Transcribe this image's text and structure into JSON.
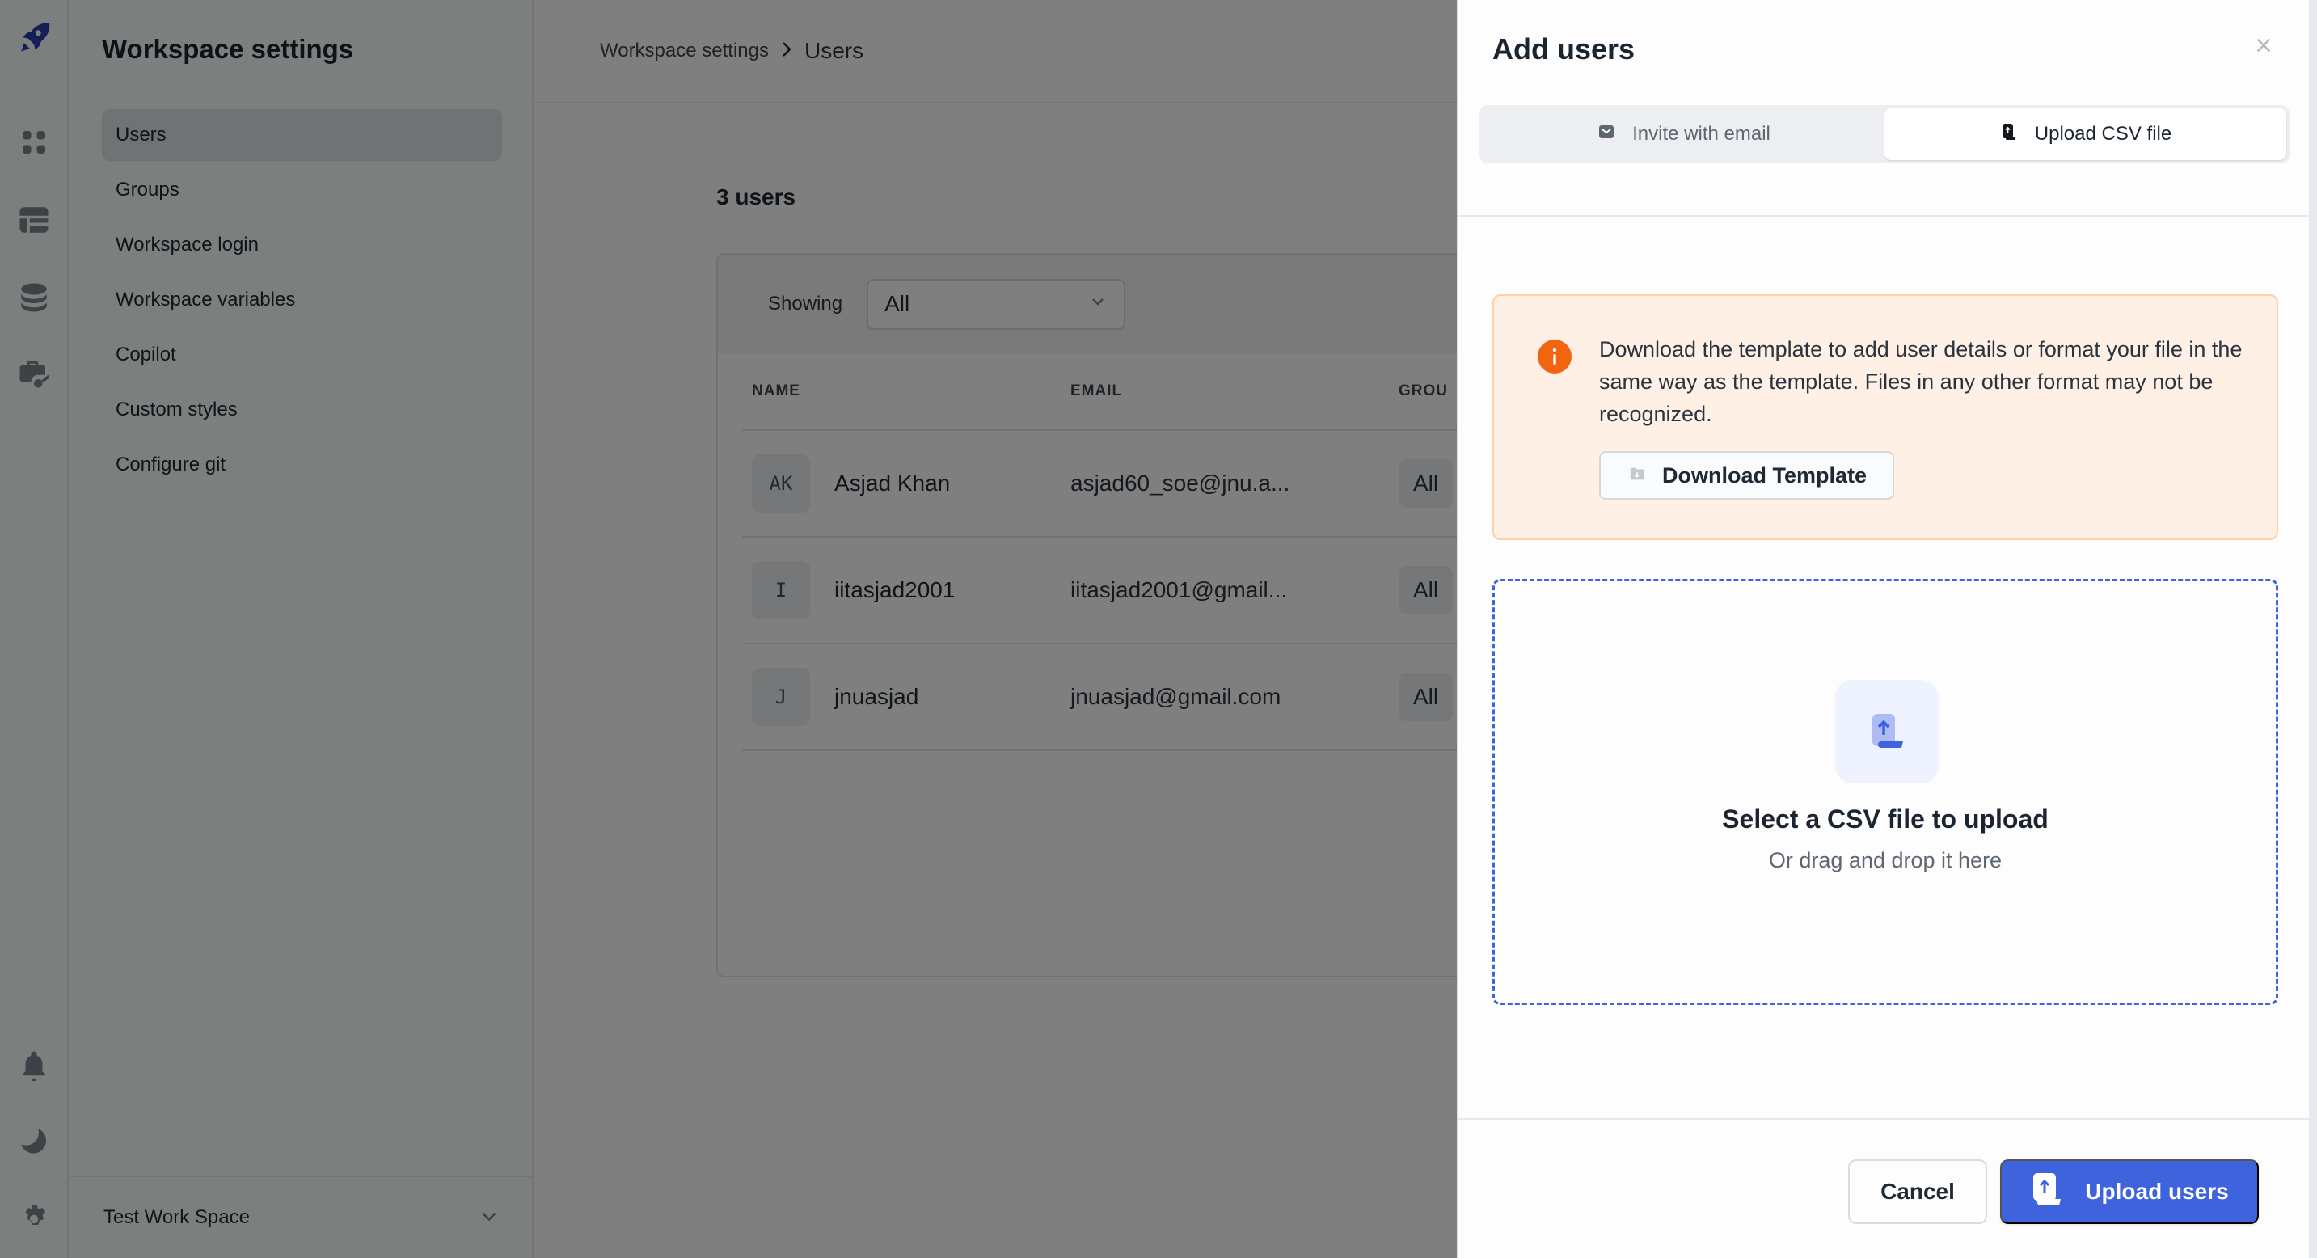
{
  "rail": {
    "icons": [
      "rocket-logo-icon",
      "apps-grid-icon",
      "table-layout-icon",
      "database-icon",
      "workspace-key-icon",
      "bell-icon",
      "moon-icon",
      "gear-icon"
    ],
    "logo_color": "#2c3cb0"
  },
  "sidebar": {
    "title": "Workspace settings",
    "items": [
      {
        "label": "Users",
        "active": true
      },
      {
        "label": "Groups",
        "active": false
      },
      {
        "label": "Workspace login",
        "active": false
      },
      {
        "label": "Workspace variables",
        "active": false
      },
      {
        "label": "Copilot",
        "active": false
      },
      {
        "label": "Custom styles",
        "active": false
      },
      {
        "label": "Configure git",
        "active": false
      }
    ],
    "workspace_name": "Test Work Space"
  },
  "main": {
    "breadcrumb": {
      "parent": "Workspace settings",
      "current": "Users"
    },
    "users_count": "3 users",
    "filter": {
      "label": "Showing",
      "value": "All"
    },
    "table": {
      "headers": {
        "name": "NAME",
        "email": "EMAIL",
        "groups": "GROU"
      },
      "rows": [
        {
          "initials": "AK",
          "name": "Asjad Khan",
          "email": "asjad60_soe@jnu.a...",
          "group": "All"
        },
        {
          "initials": "I",
          "name": "iitasjad2001",
          "email": "iitasjad2001@gmail...",
          "group": "All"
        },
        {
          "initials": "J",
          "name": "jnuasjad",
          "email": "jnuasjad@gmail.com",
          "group": "All"
        }
      ]
    }
  },
  "drawer": {
    "title": "Add users",
    "tabs": [
      {
        "label": "Invite with email",
        "icon": "mail-icon",
        "active": false
      },
      {
        "label": "Upload CSV file",
        "icon": "file-upload-icon",
        "active": true
      }
    ],
    "info": {
      "text": "Download the template to add user details or format your file in the same way as the template. Files in any other format may not be recognized.",
      "button_label": "Download Template",
      "accent_color": "#f2640f"
    },
    "dropzone": {
      "title": "Select a CSV file to upload",
      "subtitle": "Or drag and drop it here",
      "border_color": "#3d63dd"
    },
    "footer": {
      "cancel_label": "Cancel",
      "upload_label": "Upload users",
      "primary_color": "#3e63dd"
    }
  }
}
